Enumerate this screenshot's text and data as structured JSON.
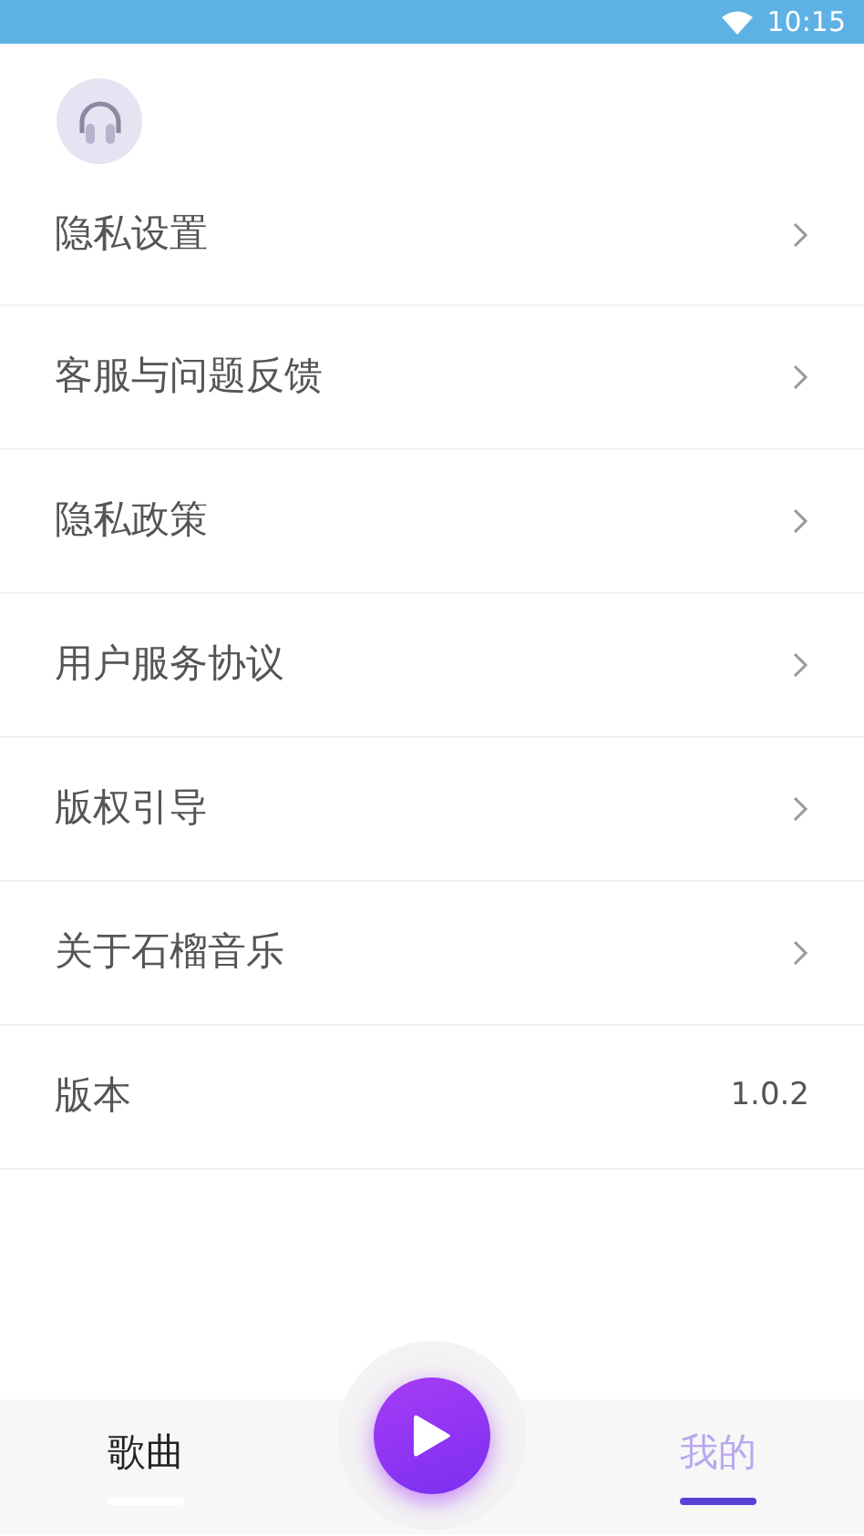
{
  "status_bar": {
    "time": "10:15"
  },
  "menu": [
    {
      "label": "隐私设置",
      "kind": "link"
    },
    {
      "label": "客服与问题反馈",
      "kind": "link"
    },
    {
      "label": "隐私政策",
      "kind": "link"
    },
    {
      "label": "用户服务协议",
      "kind": "link"
    },
    {
      "label": "版权引导",
      "kind": "link"
    },
    {
      "label": "关于石榴音乐",
      "kind": "link"
    },
    {
      "label": "版本",
      "kind": "value",
      "value": "1.0.2"
    }
  ],
  "tabs": [
    {
      "label": "歌曲",
      "selected": false
    },
    {
      "label": "我的",
      "selected": true
    }
  ]
}
